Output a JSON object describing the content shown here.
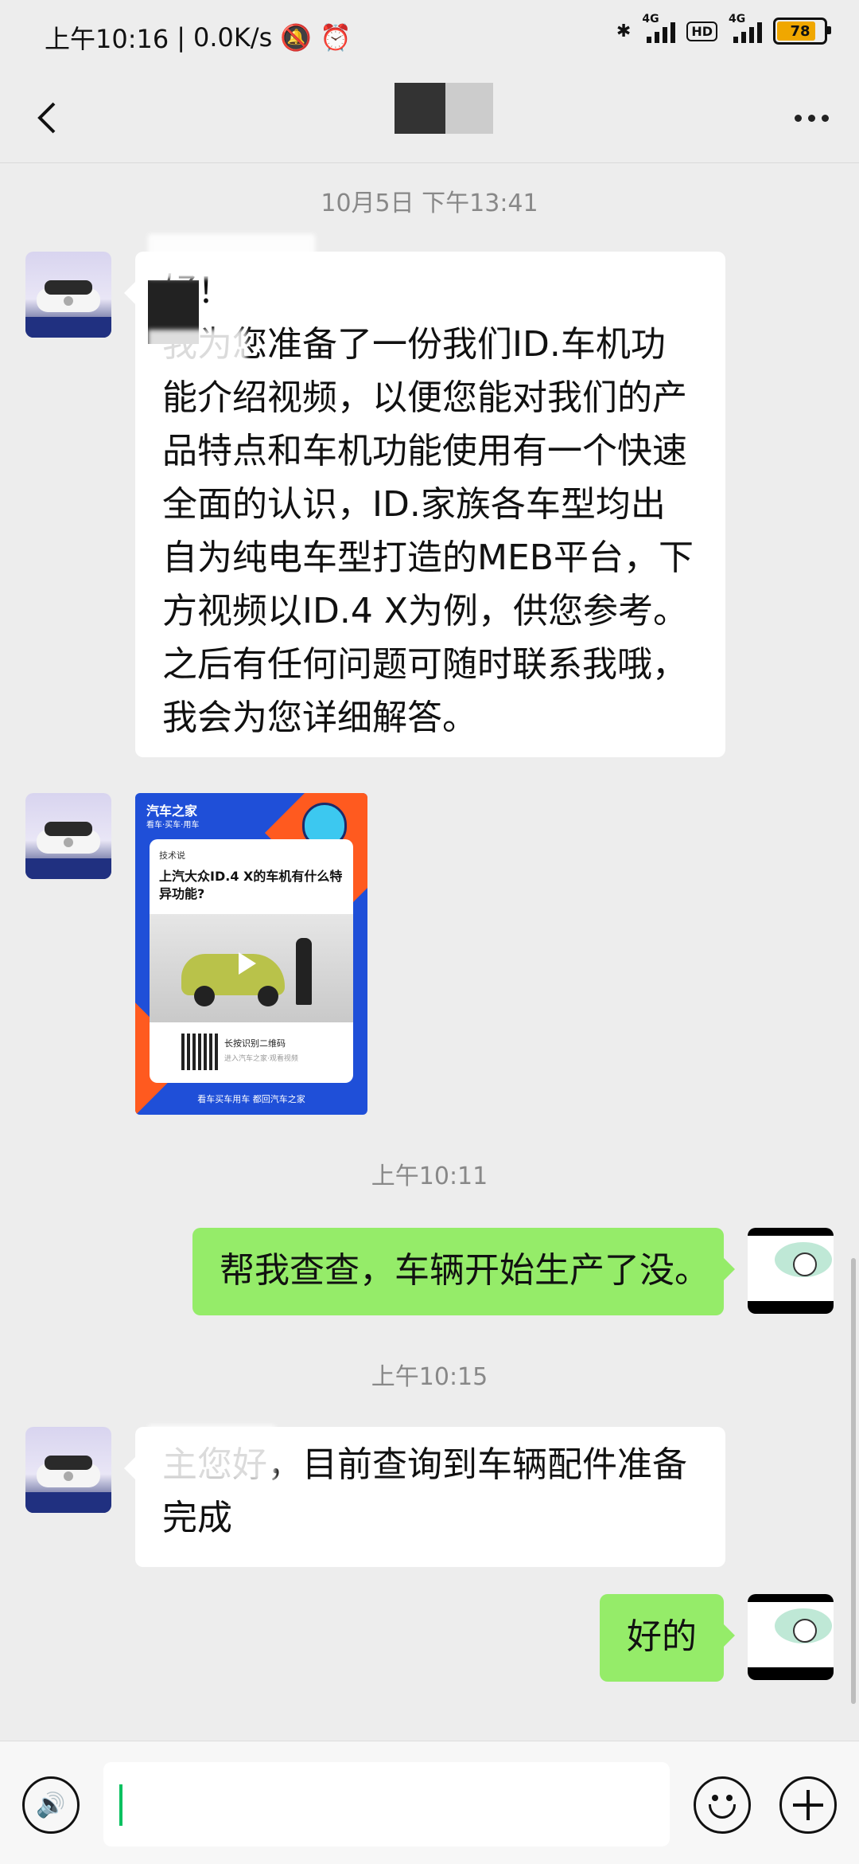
{
  "status_bar": {
    "time": "上午10:16",
    "speed": "0.0K/s",
    "battery": "78",
    "hd_label": "HD",
    "network_label_1": "4G",
    "network_label_2": "4G"
  },
  "messages": {
    "ts1": "10月5日 下午13:41",
    "msg1_text": "好！\n我为您准备了一份我们ID.车机功能介绍视频，以便您能对我们的产品特点和车机功能使用有一个快速全面的认识，ID.家族各车型均出自为纯电车型打造的MEB平台，下方视频以ID.4 X为例，供您参考。之后有任何问题可随时联系我哦，我会为您详细解答。",
    "card": {
      "brand": "汽车之家",
      "brand_sub": "看车·买车·用车",
      "tag": "技术说",
      "title": "上汽大众ID.4 X的车机有什么特异功能?",
      "qr_text": "长按识别二维码",
      "qr_sub": "进入汽车之家·观看视频",
      "footer": "看车买车用车  都回汽车之家"
    },
    "ts2": "上午10:11",
    "msg2_text": "帮我查查，车辆开始生产了没。",
    "ts3": "上午10:15",
    "msg3_text": "主您好，目前查询到车辆配件准备完成",
    "msg4_text": "好的"
  },
  "colors": {
    "chat_bg": "#ededed",
    "out_bubble": "#95ec69",
    "in_bubble": "#ffffff",
    "caret": "#07c160"
  }
}
